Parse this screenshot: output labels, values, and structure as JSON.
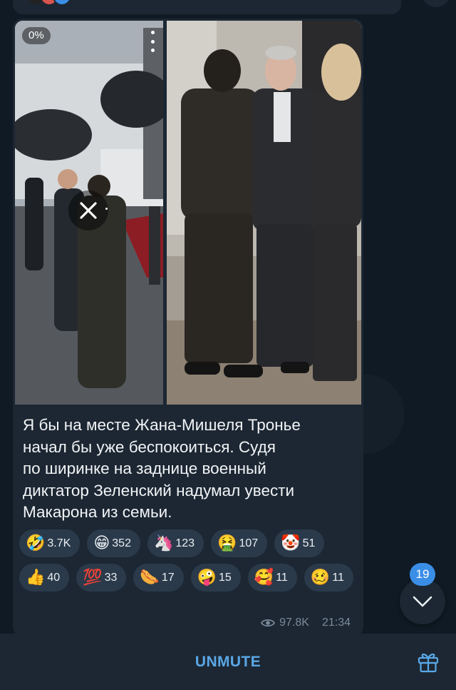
{
  "post": {
    "video_progress": "0%",
    "text": "Я бы на месте Жана-Мишеля Тронье начал бы уже беспокоиться. Судя по ширинке на заднице военный диктатор Зеленский надумал увести Макарона из семьи.",
    "text_lines": [
      "Я бы на месте Жана-Мишеля Тронье",
      "начал бы уже беспокоиться. Судя",
      "по ширинке на заднице военный",
      "диктатор Зеленский надумал увести",
      "Макарона из семьи."
    ],
    "reactions": [
      {
        "emoji": "🤣",
        "count": "3.7K"
      },
      {
        "emoji": "😁",
        "count": "352"
      },
      {
        "emoji": "🦄",
        "count": "123"
      },
      {
        "emoji": "🤮",
        "count": "107"
      },
      {
        "emoji": "🤡",
        "count": "51"
      },
      {
        "emoji": "👍",
        "count": "40"
      },
      {
        "emoji": "💯",
        "count": "33"
      },
      {
        "emoji": "🌭",
        "count": "17"
      },
      {
        "emoji": "🤪",
        "count": "15"
      },
      {
        "emoji": "🥰",
        "count": "11"
      },
      {
        "emoji": "🥴",
        "count": "11"
      }
    ],
    "views": "97.8K",
    "time": "21:34"
  },
  "unread_count": "19",
  "bottom_bar": {
    "unmute_label": "UNMUTE"
  },
  "colors": {
    "background": "#0f1a24",
    "bubble": "#1c2733",
    "accent": "#5aa7e6",
    "badge": "#3a8ee6"
  },
  "icons": [
    "eye-icon",
    "chevron-down-icon",
    "gift-icon",
    "close-icon",
    "more-vertical-icon"
  ]
}
